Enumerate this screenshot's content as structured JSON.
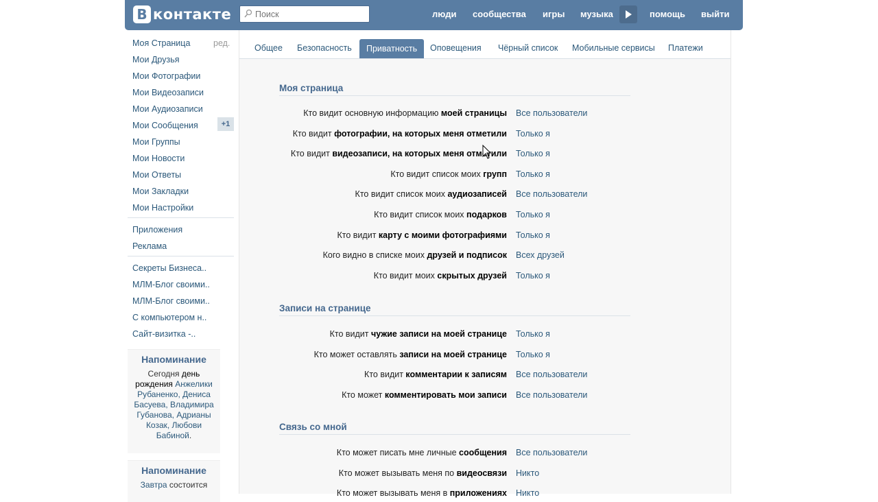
{
  "header": {
    "logo_letter": "В",
    "logo_text": "контакте",
    "search_placeholder": "Поиск",
    "nav": [
      "люди",
      "сообщества",
      "игры",
      "музыка",
      "помощь",
      "выйти"
    ],
    "colors": {
      "header_bg": "#597da3",
      "link": "#2b587a"
    }
  },
  "sidebar": {
    "edit_label": "ред.",
    "menu": [
      "Моя Страница",
      "Мои Друзья",
      "Мои Фотографии",
      "Мои Видеозаписи",
      "Мои Аудиозаписи",
      "Мои Сообщения",
      "Мои Группы",
      "Мои Новости",
      "Мои Ответы",
      "Мои Закладки",
      "Мои Настройки"
    ],
    "messages_badge": "+1",
    "extra": [
      "Приложения",
      "Реклама"
    ],
    "apps": [
      "Секреты Бизнеса..",
      "МЛМ-Блог своими..",
      "МЛМ-Блог своими..",
      "С компьютером н..",
      "Сайт-визитка -.."
    ],
    "reminder1": {
      "title": "Напоминание",
      "t1": "Сегодня ",
      "b1": "день рождения",
      "t2": " Анжелики Рубаненко, Дениса Басуева, Владимира Губанова, Адрианы Козак, Любови Бабиной",
      "t3": "."
    },
    "reminder2": {
      "title": "Напоминание",
      "t1": "Завтра",
      "t2": " состоится"
    }
  },
  "tabs": [
    "Общее",
    "Безопасность",
    "Приватность",
    "Оповещения",
    "Чёрный список",
    "Мобильные сервисы",
    "Платежи"
  ],
  "active_tab": "Приватность",
  "sections": [
    {
      "title": "Моя страница",
      "rows": [
        {
          "pre": "Кто видит основную информацию ",
          "bold": "моей страницы",
          "value": "Все пользователи"
        },
        {
          "pre": "Кто видит ",
          "bold": "фотографии, на которых меня отметили",
          "value": "Только я"
        },
        {
          "pre": "Кто видит ",
          "bold": "видеозаписи, на которых меня отметили",
          "value": "Только я"
        },
        {
          "pre": "Кто видит список моих ",
          "bold": "групп",
          "value": "Только я"
        },
        {
          "pre": "Кто видит список моих ",
          "bold": "аудиозаписей",
          "value": "Все пользователи"
        },
        {
          "pre": "Кто видит список моих ",
          "bold": "подарков",
          "value": "Только я"
        },
        {
          "pre": "Кто видит ",
          "bold": "карту с моими фотографиями",
          "value": "Только я"
        },
        {
          "pre": "Кого видно в списке моих ",
          "bold": "друзей и подписок",
          "value": "Всех друзей"
        },
        {
          "pre": "Кто видит моих ",
          "bold": "скрытых друзей",
          "value": "Только я"
        }
      ]
    },
    {
      "title": "Записи на странице",
      "rows": [
        {
          "pre": "Кто видит ",
          "bold": "чужие записи на моей странице",
          "value": "Только я"
        },
        {
          "pre": "Кто может оставлять ",
          "bold": "записи на моей странице",
          "value": "Только я"
        },
        {
          "pre": "Кто видит ",
          "bold": "комментарии к записям",
          "value": "Все пользователи"
        },
        {
          "pre": "Кто может ",
          "bold": "комментировать мои записи",
          "value": "Все пользователи"
        }
      ]
    },
    {
      "title": "Связь со мной",
      "rows": [
        {
          "pre": "Кто может писать мне личные ",
          "bold": "сообщения",
          "value": "Все пользователи"
        },
        {
          "pre": "Кто может вызывать меня по ",
          "bold": "видеосвязи",
          "value": "Никто"
        },
        {
          "pre": "Кто может вызывать меня в ",
          "bold": "приложениях",
          "value": "Никто"
        }
      ]
    }
  ]
}
